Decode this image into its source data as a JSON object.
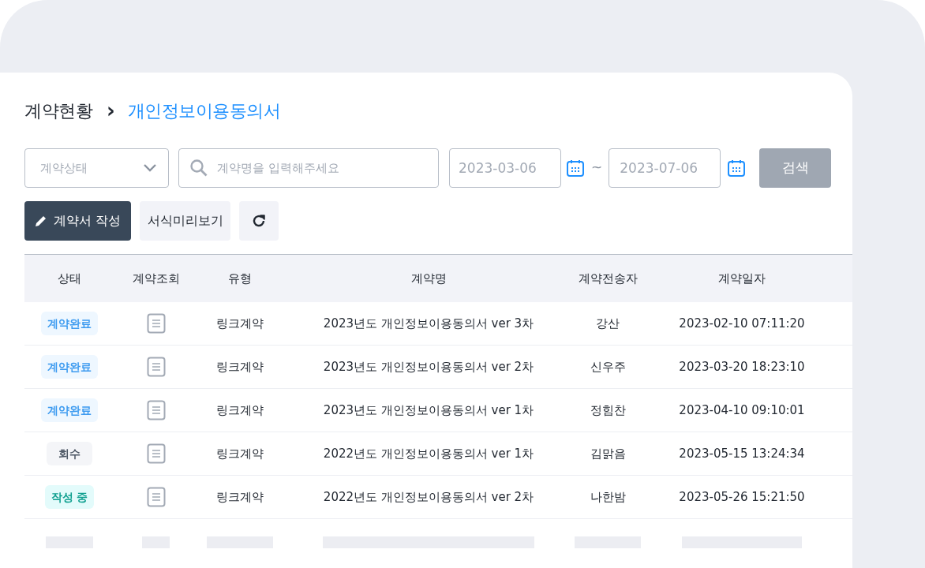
{
  "breadcrumb": {
    "parent": "계약현황",
    "separator": "›",
    "current": "개인정보이용동의서"
  },
  "filters": {
    "status_select": {
      "placeholder": "계약상태"
    },
    "search": {
      "placeholder": "계약명을 입력해주세요"
    },
    "date_from": {
      "value": "2023-03-06"
    },
    "range_separator": "~",
    "date_to": {
      "value": "2023-07-06"
    },
    "search_button": "검색"
  },
  "actions": {
    "create_button": "계약서 작성",
    "preview_button": "서식미리보기"
  },
  "table": {
    "columns": [
      "상태",
      "계약조회",
      "유형",
      "계약명",
      "계약전송자",
      "계약일자"
    ],
    "rows": [
      {
        "status": {
          "label": "계약완료",
          "kind": "complete"
        },
        "type": "링크계약",
        "name": "2023년도 개인정보이용동의서 ver 3차",
        "sender": "강산",
        "date": "2023-02-10 07:11:20"
      },
      {
        "status": {
          "label": "계약완료",
          "kind": "complete"
        },
        "type": "링크계약",
        "name": "2023년도 개인정보이용동의서 ver 2차",
        "sender": "신우주",
        "date": "2023-03-20 18:23:10"
      },
      {
        "status": {
          "label": "계약완료",
          "kind": "complete"
        },
        "type": "링크계약",
        "name": "2023년도 개인정보이용동의서 ver 1차",
        "sender": "정힘찬",
        "date": "2023-04-10 09:10:01"
      },
      {
        "status": {
          "label": "회수",
          "kind": "revoked"
        },
        "type": "링크계약",
        "name": "2022년도 개인정보이용동의서 ver 1차",
        "sender": "김맑음",
        "date": "2023-05-15 13:24:34"
      },
      {
        "status": {
          "label": "작성 중",
          "kind": "drafting"
        },
        "type": "링크계약",
        "name": "2022년도 개인정보이용동의서 ver 2차",
        "sender": "나한밤",
        "date": "2023-05-26 15:21:50"
      }
    ]
  }
}
